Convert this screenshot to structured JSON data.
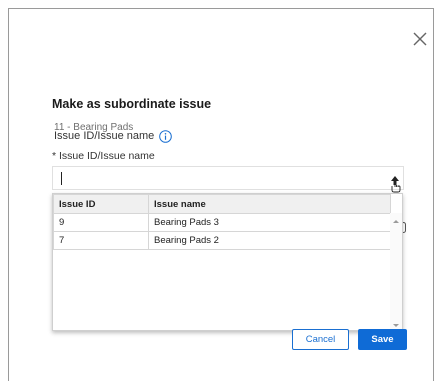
{
  "dialog": {
    "title": "Make as subordinate issue",
    "readonly_label": "Issue ID/Issue name",
    "readonly_value": "11 - Bearing Pads",
    "field_label": "* Issue ID/Issue name",
    "input_value": "",
    "icons": {
      "close": "close-icon",
      "info": "info-icon",
      "upload": "upload-icon"
    }
  },
  "dropdown": {
    "columns": [
      "Issue ID",
      "Issue name"
    ],
    "rows": [
      {
        "id": "9",
        "name": "Bearing Pads 3"
      },
      {
        "id": "7",
        "name": "Bearing Pads 2"
      }
    ]
  },
  "footer": {
    "cancel_label": "Cancel",
    "save_label": "Save"
  },
  "colors": {
    "accent": "#0f6bd6",
    "info_icon": "#1a6fd1"
  }
}
